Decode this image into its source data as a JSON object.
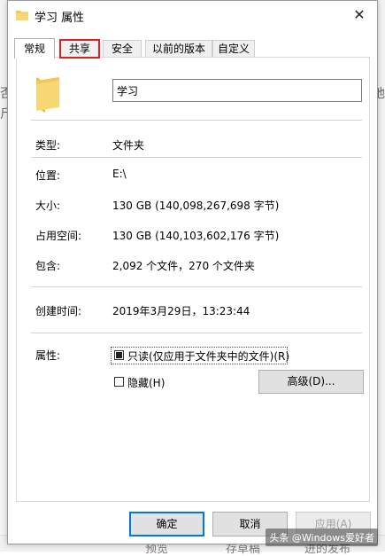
{
  "window": {
    "title": "学习 属性",
    "close": "✕"
  },
  "tabs": [
    {
      "label": "常规"
    },
    {
      "label": "共享"
    },
    {
      "label": "安全"
    },
    {
      "label": "以前的版本"
    },
    {
      "label": "自定义"
    }
  ],
  "general": {
    "name_value": "学习",
    "rows": [
      {
        "label": "类型:",
        "value": "文件夹"
      },
      {
        "label": "位置:",
        "value": "E:\\"
      },
      {
        "label": "大小:",
        "value": "130 GB (140,098,267,698 字节)"
      },
      {
        "label": "占用空间:",
        "value": "130 GB (140,103,602,176 字节)"
      },
      {
        "label": "包含:",
        "value": "2,092 个文件，270 个文件夹"
      }
    ],
    "created_label": "创建时间:",
    "created_value": "2019年3月29日，13:23:44",
    "attributes_label": "属性:",
    "readonly_label": "只读(仅应用于文件夹中的文件)(R)",
    "hidden_label": "隐藏(H)",
    "advanced_label": "高级(D)..."
  },
  "footer": {
    "ok": "确定",
    "cancel": "取消",
    "apply": "应用(A)"
  },
  "background": {
    "glyph_a": "否",
    "glyph_b": "斤",
    "glyph_c": "地",
    "btn_a": "预览",
    "btn_b": "存草稿",
    "btn_c": "进的发布"
  },
  "watermark": "头条 @Windows爱好者",
  "colors": {
    "tab_highlight": "#e02020",
    "default_button": "#0078d7",
    "folder": "#f5c75a"
  }
}
